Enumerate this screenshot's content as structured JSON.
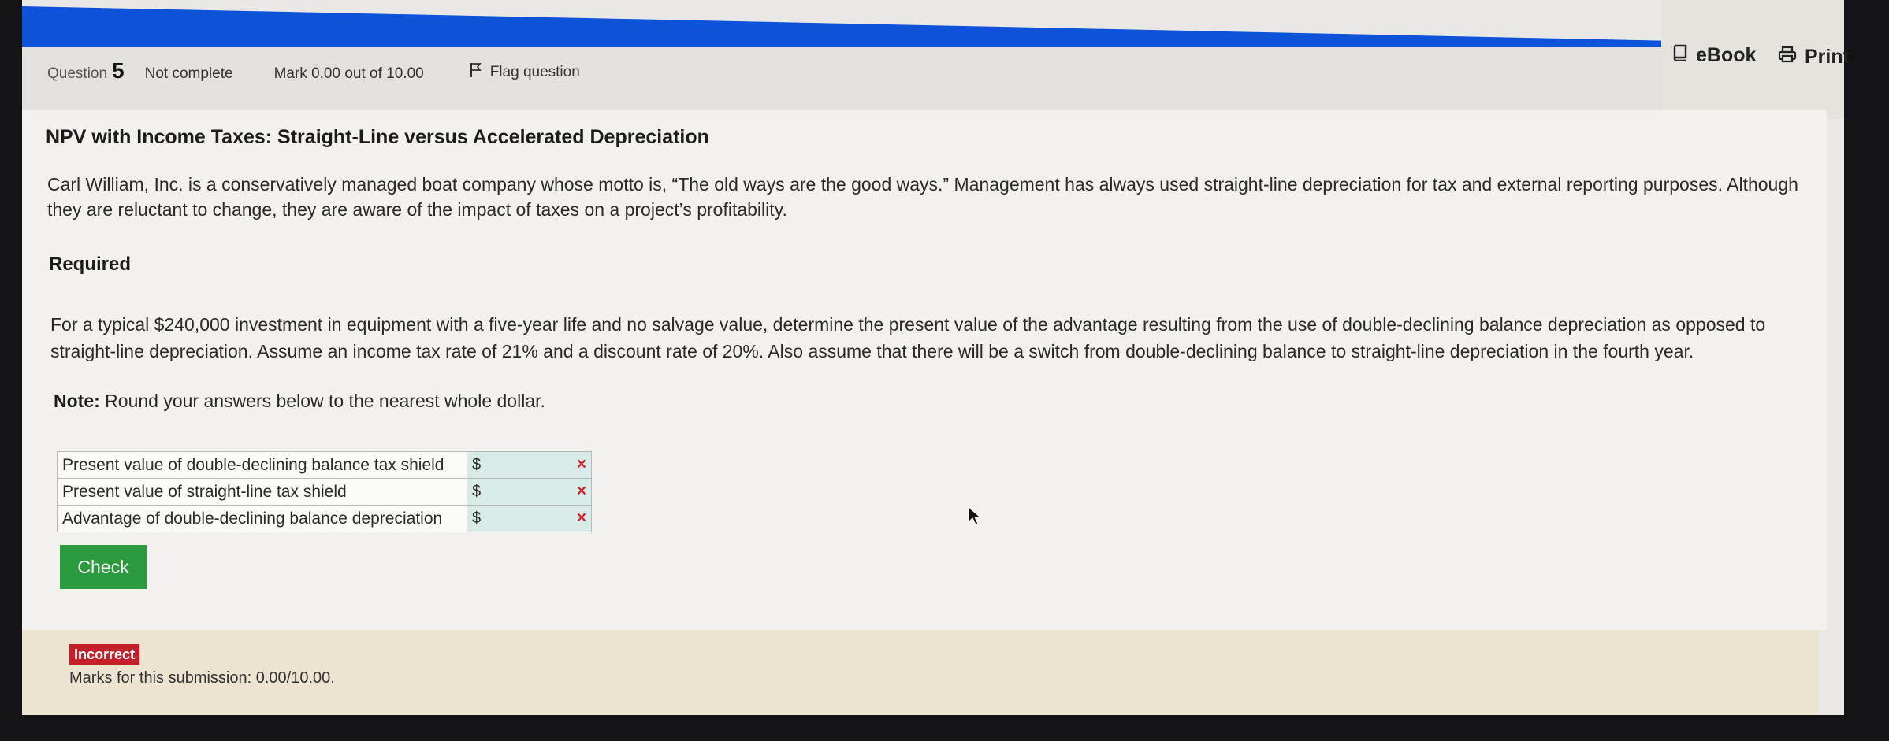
{
  "toolbar": {
    "ebook_label": "eBook",
    "print_label": "Print"
  },
  "question_info": {
    "label": "Question",
    "number": "5",
    "status": "Not complete",
    "mark": "Mark 0.00 out of 10.00",
    "flag_label": "Flag question"
  },
  "problem": {
    "title": "NPV with Income Taxes: Straight-Line versus Accelerated Depreciation",
    "intro": "Carl William, Inc. is a conservatively managed boat company whose motto is, “The old ways are the good ways.” Management has always used straight-line depreciation for tax and external reporting purposes. Although they are reluctant to change, they are aware of the impact of taxes on a project’s profitability.",
    "required_heading": "Required",
    "required_text": "For a typical $240,000 investment in equipment with a five-year life and no salvage value, determine the present value of the advantage resulting from the use of double-declining balance depreciation as opposed to straight-line depreciation. Assume an income tax rate of 21% and a discount rate of 20%. Also assume that there will be a switch from double-declining balance to straight-line depreciation in the fourth year.",
    "note_label": "Note:",
    "note_text": "Round your answers below to the nearest whole dollar."
  },
  "answers": [
    {
      "label": "Present value of double-declining balance tax shield",
      "currency": "$",
      "value": "",
      "result": "×"
    },
    {
      "label": "Present value of straight-line tax shield",
      "currency": "$",
      "value": "",
      "result": "×"
    },
    {
      "label": "Advantage of double-declining balance depreciation",
      "currency": "$",
      "value": "",
      "result": "×"
    }
  ],
  "check_label": "Check",
  "feedback": {
    "badge": "Incorrect",
    "marks": "Marks for this submission: 0.00/10.00."
  },
  "colors": {
    "header_blue": "#0d52d8",
    "check_green": "#2a9a3c",
    "incorrect_red": "#c4202a",
    "input_bg": "#d8ebe8"
  }
}
